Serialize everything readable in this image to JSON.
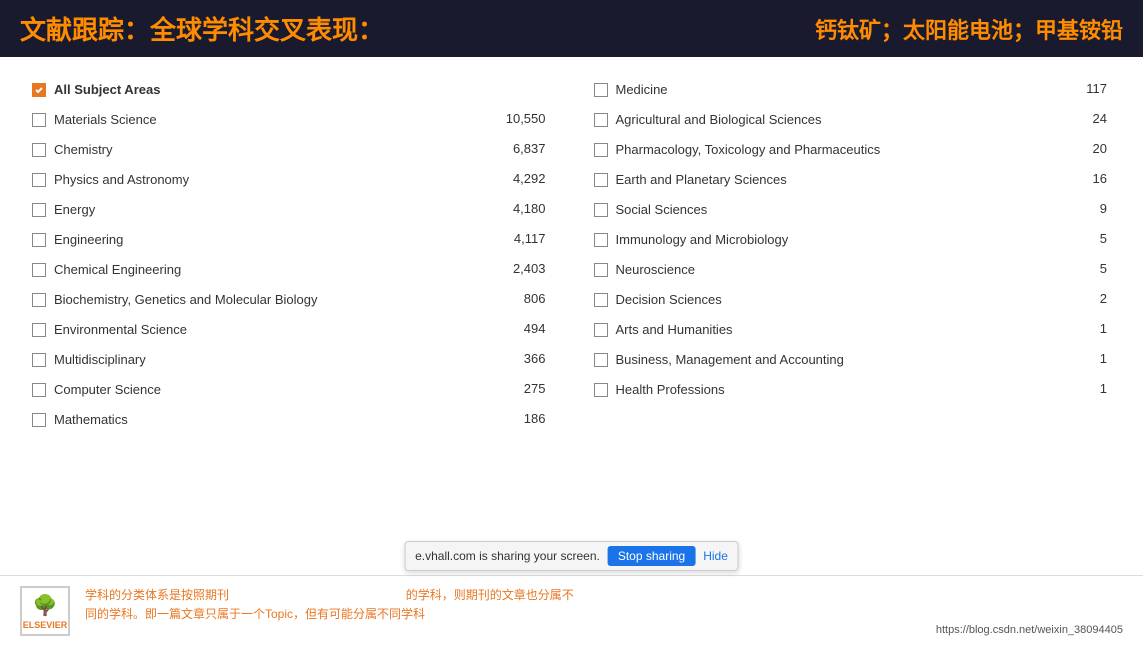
{
  "header": {
    "title": "文献跟踪：全球学科交叉表现：",
    "keywords": "钙钛矿；太阳能电池；甲基铵铅"
  },
  "left_column": {
    "items": [
      {
        "label": "All Subject Areas",
        "count": "",
        "checked": true,
        "all": true
      },
      {
        "label": "Materials Science",
        "count": "10,550",
        "checked": false
      },
      {
        "label": "Chemistry",
        "count": "6,837",
        "checked": false
      },
      {
        "label": "Physics and Astronomy",
        "count": "4,292",
        "checked": false
      },
      {
        "label": "Energy",
        "count": "4,180",
        "checked": false
      },
      {
        "label": "Engineering",
        "count": "4,117",
        "checked": false
      },
      {
        "label": "Chemical Engineering",
        "count": "2,403",
        "checked": false
      },
      {
        "label": "Biochemistry, Genetics and Molecular Biology",
        "count": "806",
        "checked": false
      },
      {
        "label": "Environmental Science",
        "count": "494",
        "checked": false
      },
      {
        "label": "Multidisciplinary",
        "count": "366",
        "checked": false
      },
      {
        "label": "Computer Science",
        "count": "275",
        "checked": false
      },
      {
        "label": "Mathematics",
        "count": "186",
        "checked": false
      }
    ]
  },
  "right_column": {
    "items": [
      {
        "label": "Medicine",
        "count": "117",
        "checked": false
      },
      {
        "label": "Agricultural and Biological Sciences",
        "count": "24",
        "checked": false
      },
      {
        "label": "Pharmacology, Toxicology and Pharmaceutics",
        "count": "20",
        "checked": false
      },
      {
        "label": "Earth and Planetary Sciences",
        "count": "16",
        "checked": false
      },
      {
        "label": "Social Sciences",
        "count": "9",
        "checked": false
      },
      {
        "label": "Immunology and Microbiology",
        "count": "5",
        "checked": false
      },
      {
        "label": "Neuroscience",
        "count": "5",
        "checked": false
      },
      {
        "label": "Decision Sciences",
        "count": "2",
        "checked": false
      },
      {
        "label": "Arts and Humanities",
        "count": "1",
        "checked": false
      },
      {
        "label": "Business, Management and Accounting",
        "count": "1",
        "checked": false
      },
      {
        "label": "Health Professions",
        "count": "1",
        "checked": false
      }
    ]
  },
  "footer": {
    "text_line1": "学科的分类体系是按照期刊         e.vhall.com is sharing your screen.      的学科，则期刊的文章也分属不",
    "text_line2": "同的学科。即一篇文章只属于一个Topic，但有可能分属不同学科",
    "logo_label": "ELSEVIER",
    "url": "https://blog.csdn.net/weixin_38094405"
  },
  "screen_share": {
    "text": "e.vhall.com is sharing your screen.",
    "stop_label": "Stop sharing",
    "hide_label": "Hide"
  }
}
